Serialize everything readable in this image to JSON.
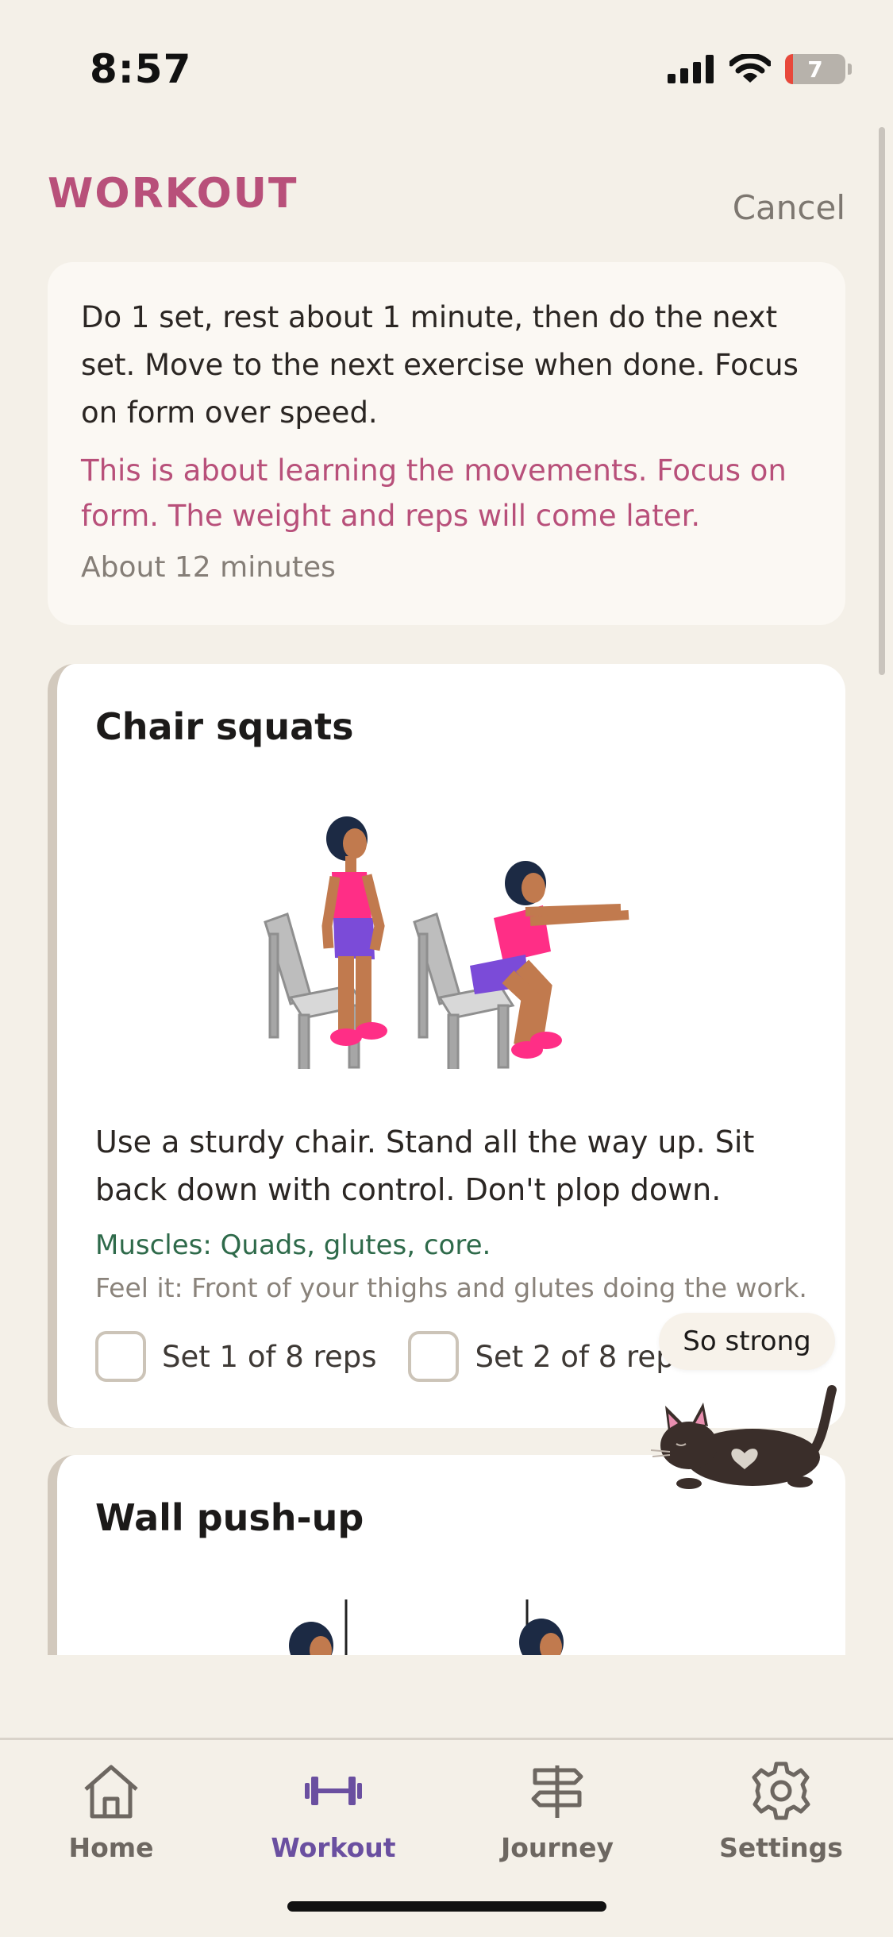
{
  "status_bar": {
    "time": "8:57",
    "battery": "7"
  },
  "header": {
    "title": "WORKOUT",
    "cancel_label": "Cancel"
  },
  "intro": {
    "instructions": "Do 1 set, rest about 1 minute, then do the next set. Move to the next exercise when done. Focus on form over speed.",
    "note": "This is about learning the movements. Focus on form. The weight and reps will come later.",
    "duration": "About 12 minutes"
  },
  "exercises": [
    {
      "name": "Chair squats",
      "description": "Use a sturdy chair. Stand all the way up. Sit back down with control. Don't plop down.",
      "muscles": "Muscles: Quads, glutes, core.",
      "feel": "Feel it: Front of your thighs and glutes doing the work.",
      "sets": [
        {
          "label": "Set 1 of 8 reps",
          "checked": false
        },
        {
          "label": "Set 2 of 8 reps",
          "checked": false
        }
      ]
    },
    {
      "name": "Wall push-up"
    }
  ],
  "mascot": {
    "message": "So strong"
  },
  "tabs": [
    {
      "label": "Home",
      "icon": "home-icon",
      "active": false
    },
    {
      "label": "Workout",
      "icon": "dumbbell-icon",
      "active": true
    },
    {
      "label": "Journey",
      "icon": "signpost-icon",
      "active": false
    },
    {
      "label": "Settings",
      "icon": "gear-icon",
      "active": false
    }
  ],
  "colors": {
    "accent": "#b8507a",
    "tab_active": "#6a4fa0",
    "muscles": "#2e6a4a",
    "background": "#f4f0e8"
  }
}
